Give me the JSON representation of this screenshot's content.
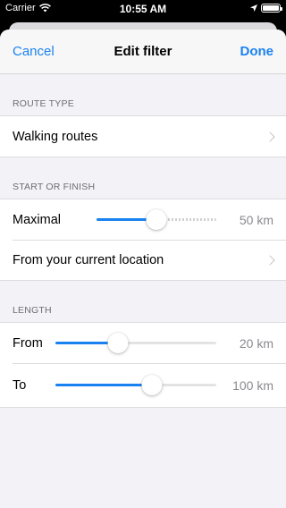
{
  "status_bar": {
    "carrier": "Carrier",
    "time": "10:55 AM"
  },
  "navbar": {
    "cancel_label": "Cancel",
    "title": "Edit filter",
    "done_label": "Done"
  },
  "sections": {
    "route_type": {
      "header": "ROUTE TYPE",
      "value": "Walking routes"
    },
    "start_finish": {
      "header": "START OR FINISH",
      "maximal_label": "Maximal",
      "maximal_value": "50 km",
      "maximal_fraction": 0.5,
      "location_label": "From your current location"
    },
    "length": {
      "header": "LENGTH",
      "from_label": "From",
      "from_value": "20 km",
      "from_fraction": 0.39,
      "to_label": "To",
      "to_value": "100 km",
      "to_fraction": 0.6
    }
  },
  "colors": {
    "accent": "#1a82f0",
    "background": "#f2f2f7"
  }
}
